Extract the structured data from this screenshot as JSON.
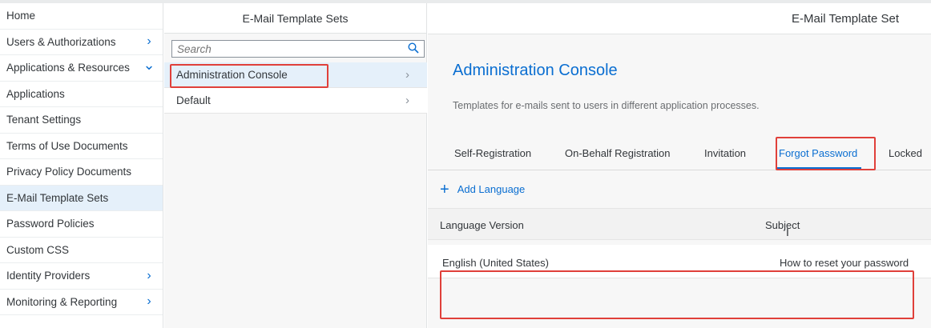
{
  "nav": {
    "items": [
      {
        "label": "Home",
        "chevron": ""
      },
      {
        "label": "Users & Authorizations",
        "chevron": "›"
      },
      {
        "label": "Applications & Resources",
        "chevron": "⌄"
      },
      {
        "label": "Applications",
        "chevron": ""
      },
      {
        "label": "Tenant Settings",
        "chevron": ""
      },
      {
        "label": "Terms of Use Documents",
        "chevron": ""
      },
      {
        "label": "Privacy Policy Documents",
        "chevron": ""
      },
      {
        "label": "E-Mail Template Sets",
        "chevron": ""
      },
      {
        "label": "Password Policies",
        "chevron": ""
      },
      {
        "label": "Custom CSS",
        "chevron": ""
      },
      {
        "label": "Identity Providers",
        "chevron": "›"
      },
      {
        "label": "Monitoring & Reporting",
        "chevron": "›"
      }
    ],
    "selected": "E-Mail Template Sets"
  },
  "master": {
    "title": "E-Mail Template Sets",
    "search_placeholder": "Search",
    "items": [
      {
        "label": "Administration Console"
      },
      {
        "label": "Default"
      }
    ]
  },
  "detail": {
    "header": "E-Mail Template Set",
    "title": "Administration Console",
    "subtitle": "Templates for e-mails sent to users in different application processes.",
    "tabs": [
      "Self-Registration",
      "On-Behalf Registration",
      "Invitation",
      "Forgot Password",
      "Locked"
    ],
    "active_tab": "Forgot Password",
    "add_language": "Add Language",
    "table": {
      "columns": [
        "Language Version",
        "Subject"
      ],
      "rows": [
        {
          "language": "English (United States)",
          "subject": "How to reset your password"
        }
      ]
    }
  },
  "colors": {
    "accent": "#0a6ed1",
    "annotation": "#e0403a",
    "selected_bg": "#e5f0fa"
  }
}
